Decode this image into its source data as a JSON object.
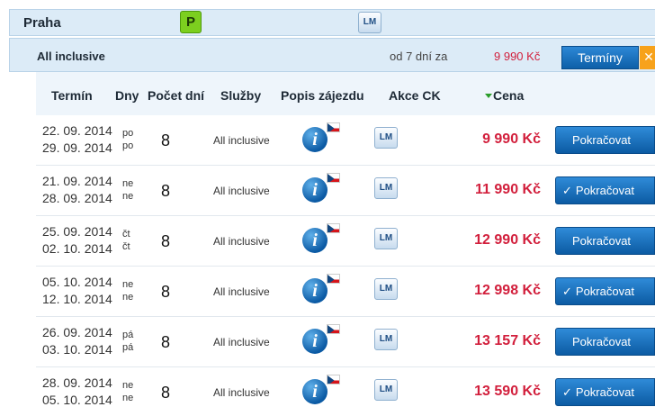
{
  "header": {
    "city": "Praha",
    "parking_label": "P",
    "lm_label": "LM"
  },
  "offer": {
    "board": "All inclusive",
    "nights": "od 7 dní za",
    "price": "9 990 Kč",
    "dates_button": "Termíny",
    "close_glyph": "✕"
  },
  "table": {
    "columns": {
      "term": "Termín",
      "days_of_week": "Dny",
      "num_days": "Počet dní",
      "services": "Služby",
      "description": "Popis zájezdu",
      "promo": "Akce CK",
      "price": "Cena"
    },
    "rows": [
      {
        "date_from": "22. 09. 2014",
        "date_to": "29. 09. 2014",
        "day_from": "po",
        "day_to": "po",
        "days": "8",
        "service": "All inclusive",
        "lm": "LM",
        "price": "9 990 Kč",
        "button": "Pokračovat",
        "checked": false
      },
      {
        "date_from": "21. 09. 2014",
        "date_to": "28. 09. 2014",
        "day_from": "ne",
        "day_to": "ne",
        "days": "8",
        "service": "All inclusive",
        "lm": "LM",
        "price": "11 990 Kč",
        "button": "Pokračovat",
        "checked": true
      },
      {
        "date_from": "25. 09. 2014",
        "date_to": "02. 10. 2014",
        "day_from": "čt",
        "day_to": "čt",
        "days": "8",
        "service": "All inclusive",
        "lm": "LM",
        "price": "12 990 Kč",
        "button": "Pokračovat",
        "checked": false
      },
      {
        "date_from": "05. 10. 2014",
        "date_to": "12. 10. 2014",
        "day_from": "ne",
        "day_to": "ne",
        "days": "8",
        "service": "All inclusive",
        "lm": "LM",
        "price": "12 998 Kč",
        "button": "Pokračovat",
        "checked": true
      },
      {
        "date_from": "26. 09. 2014",
        "date_to": "03. 10. 2014",
        "day_from": "pá",
        "day_to": "pá",
        "days": "8",
        "service": "All inclusive",
        "lm": "LM",
        "price": "13 157 Kč",
        "button": "Pokračovat",
        "checked": false
      },
      {
        "date_from": "28. 09. 2014",
        "date_to": "05. 10. 2014",
        "day_from": "ne",
        "day_to": "ne",
        "days": "8",
        "service": "All inclusive",
        "lm": "LM",
        "price": "13 590 Kč",
        "button": "Pokračovat",
        "checked": true
      }
    ]
  },
  "colors": {
    "accent_blue": "#0c5ba3",
    "price_red": "#d21f3c",
    "parking_green": "#7ccf1f",
    "close_orange": "#f7a21b"
  }
}
